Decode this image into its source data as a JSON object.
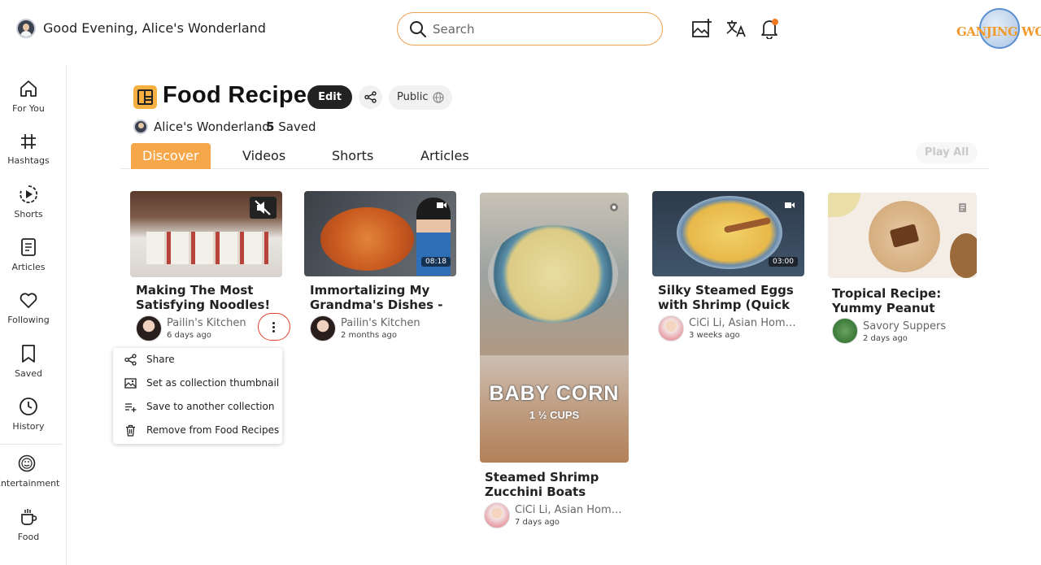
{
  "header": {
    "greeting": "Good Evening, Alice's Wonderland",
    "search_placeholder": "Search",
    "logo_text": "GANJING WORLD"
  },
  "sidebar": {
    "items": [
      {
        "label": "For You",
        "icon": "home-icon"
      },
      {
        "label": "Hashtags",
        "icon": "hashtag-icon"
      },
      {
        "label": "Shorts",
        "icon": "shorts-icon"
      },
      {
        "label": "Articles",
        "icon": "article-icon"
      },
      {
        "label": "Following",
        "icon": "heart-icon"
      },
      {
        "label": "Saved",
        "icon": "bookmark-icon"
      },
      {
        "label": "History",
        "icon": "clock-icon"
      },
      {
        "label": "Entertainment",
        "icon": "entertainment-icon"
      },
      {
        "label": "Food",
        "icon": "cup-icon"
      }
    ]
  },
  "collection": {
    "title": "Food Recipes",
    "edit_label": "Edit",
    "visibility": "Public",
    "owner": "Alice's Wonderland",
    "saved_count": "5",
    "saved_label": "Saved"
  },
  "tabs": [
    {
      "label": "Discover",
      "active": true
    },
    {
      "label": "Videos",
      "active": false
    },
    {
      "label": "Shorts",
      "active": false
    },
    {
      "label": "Articles",
      "active": false
    }
  ],
  "play_all_label": "Play All",
  "cards": [
    {
      "title": "Making The Most Satisfying Noodles!",
      "author": "Pailin's Kitchen",
      "time": "6 days ago",
      "badge": ""
    },
    {
      "title": "Immortalizing My Grandma's Dishes - Shrimp",
      "author": "Pailin's Kitchen",
      "time": "2 months ago",
      "badge": "08:18"
    },
    {
      "title": "Steamed Shrimp Zucchini Boats #Shorts",
      "author": "CiCi Li, Asian Home Cooking",
      "time": "7 days ago",
      "badge": "",
      "overlay_line1": "BABY CORN",
      "overlay_line2": "1 ½ CUPS"
    },
    {
      "title": "Silky Steamed Eggs with Shrimp (Quick & Easy Recipe)",
      "author": "CiCi Li, Asian Home Cooking",
      "time": "3 weeks ago",
      "badge": "03:00"
    },
    {
      "title": "Tropical Recipe: Yummy Peanut Butter Cup Smoothie",
      "author": "Savory Suppers",
      "time": "2 days ago",
      "badge": ""
    }
  ],
  "context_menu": [
    {
      "label": "Share",
      "icon": "share-icon"
    },
    {
      "label": "Set as collection thumbnail",
      "icon": "image-icon"
    },
    {
      "label": "Save to another collection",
      "icon": "playlist-add-icon"
    },
    {
      "label": "Remove from Food Recipes",
      "icon": "trash-icon"
    }
  ],
  "colors": {
    "accent": "#f6a74a",
    "search_border": "#f0a050",
    "notification_dot": "#f07a20",
    "kebab_highlight": "#e0402a"
  }
}
